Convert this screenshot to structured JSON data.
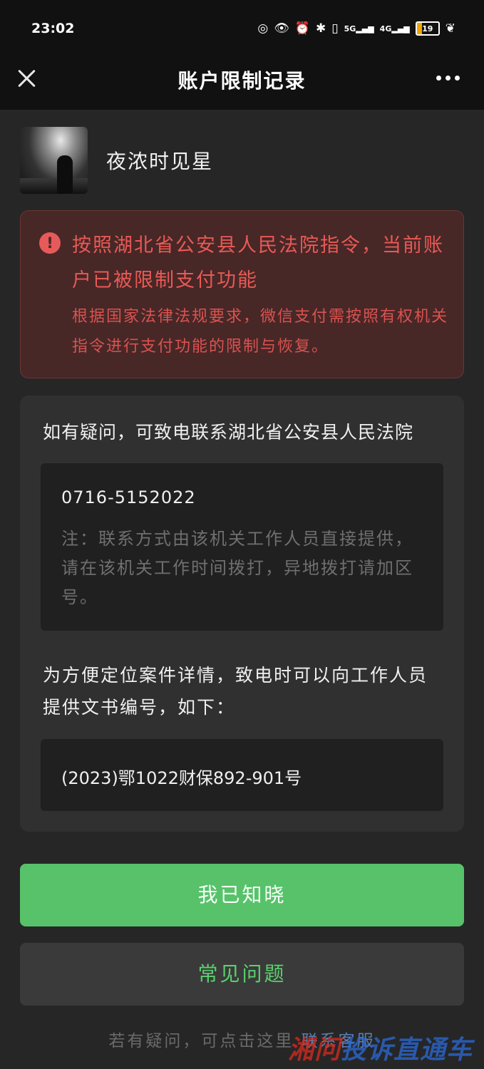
{
  "status_bar": {
    "time": "23:02",
    "signal_1_label": "5G",
    "signal_2_label": "4G",
    "battery_level": "19"
  },
  "header": {
    "title": "账户限制记录"
  },
  "user": {
    "name": "夜浓时见星"
  },
  "alert": {
    "title": "按照湖北省公安县人民法院指令，当前账户已被限制支付功能",
    "body": "根据国家法律法规要求，微信支付需按照有权机关指令进行支付功能的限制与恢复。"
  },
  "contact": {
    "prompt": "如有疑问，可致电联系湖北省公安县人民法院",
    "phone": "0716-5152022",
    "note": "注：联系方式由该机关工作人员直接提供，请在该机关工作时间拨打，异地拨打请加区号。"
  },
  "document": {
    "prompt": "为方便定位案件详情，致电时可以向工作人员提供文书编号，如下：",
    "number": "(2023)鄂1022财保892-901号"
  },
  "actions": {
    "acknowledge": "我已知晓",
    "faq": "常见问题"
  },
  "footer": {
    "text": "若有疑问，可点击这里",
    "link": "联系客服"
  },
  "watermark": {
    "part1": "湘问",
    "part2": "投诉直通车"
  },
  "colors": {
    "accent_green": "#57c26a",
    "alert_red": "#e85a55",
    "link_blue": "#5a7fb0"
  }
}
